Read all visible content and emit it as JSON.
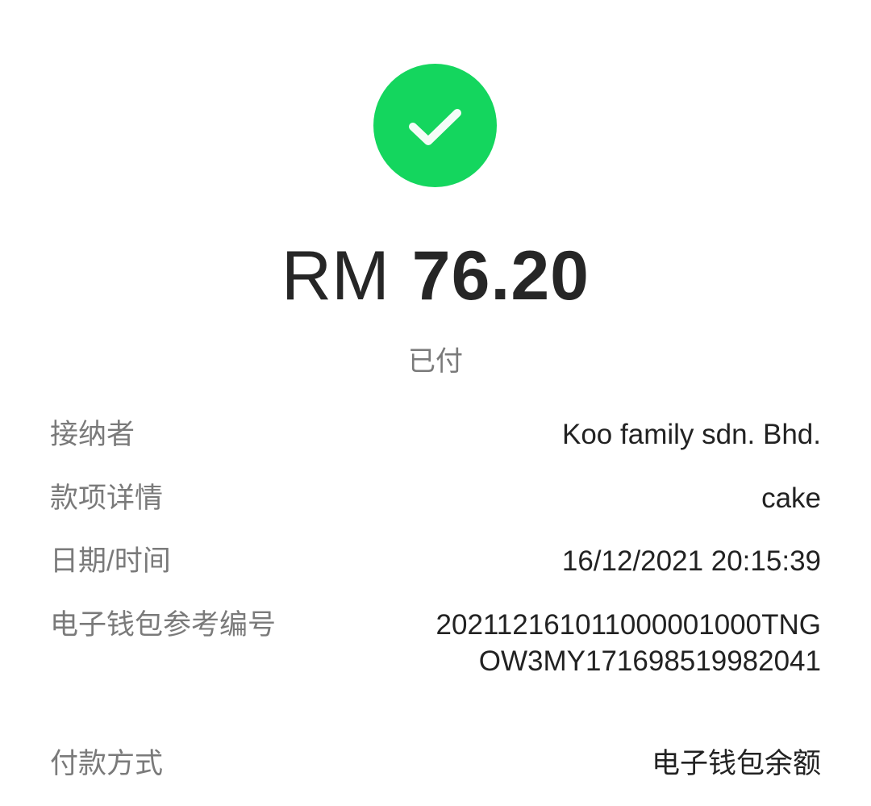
{
  "payment": {
    "currency": "RM",
    "amount": "76.20",
    "status": "已付",
    "status_icon": "check-icon",
    "status_color": "#14d65e"
  },
  "details": [
    {
      "label": "接纳者",
      "value": "Koo family sdn. Bhd."
    },
    {
      "label": "款项详情",
      "value": "cake"
    },
    {
      "label": "日期/时间",
      "value": "16/12/2021 20:15:39"
    },
    {
      "label": "电子钱包参考编号",
      "value": "20211216101100000100​0TNGOW3MY1716985199​82041"
    },
    {
      "label": "付款方式",
      "value": "电子钱包余额"
    }
  ]
}
